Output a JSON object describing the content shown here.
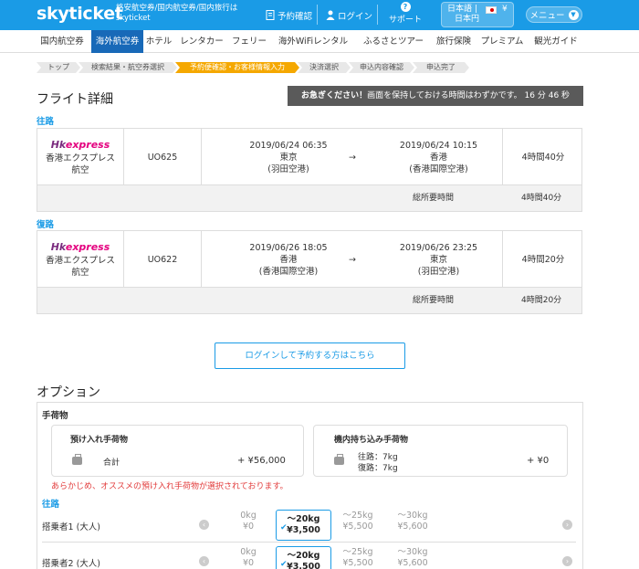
{
  "header": {
    "logo": "skyticket",
    "tagline": "格安航空券/国内航空券/国内旅行は skyticket",
    "booking_check": "予約確認",
    "login": "ログイン",
    "support": "サポート",
    "lang_line1": "日本語 |",
    "lang_line2": "日本円",
    "currency": "¥",
    "menu": "メニュー"
  },
  "nav": [
    "国内航空券",
    "海外航空券",
    "ホテル",
    "レンタカー",
    "フェリー",
    "海外WiFiレンタル",
    "ふるさとツアー",
    "旅行保険",
    "プレミアム",
    "観光ガイド"
  ],
  "breadcrumb": [
    "トップ",
    "検索結果・航空券選択",
    "予約便確認・お客様情報入力",
    "決済選択",
    "申込内容確認",
    "申込完了"
  ],
  "flight_detail": {
    "title": "フライト詳細",
    "timer_bold": "お急ぎください！",
    "timer_text": "画面を保持しておける時間はわずかです。 16 分 46 秒",
    "total_label": "総所要時間",
    "arrow": "→"
  },
  "outbound": {
    "label": "往路",
    "logo_hk": "Hk",
    "logo_express": "express",
    "airline": "香港エクスプレス航空",
    "flight_no": "UO625",
    "dep_time": "2019/06/24 06:35",
    "dep_city": "東京",
    "dep_airport": "(羽田空港)",
    "arr_time": "2019/06/24 10:15",
    "arr_city": "香港",
    "arr_airport": "(香港国際空港)",
    "duration": "4時間40分",
    "total": "4時間40分"
  },
  "return": {
    "label": "復路",
    "logo_hk": "Hk",
    "logo_express": "express",
    "airline": "香港エクスプレス航空",
    "flight_no": "UO622",
    "dep_time": "2019/06/26 18:05",
    "dep_city": "香港",
    "dep_airport": "(香港国際空港)",
    "arr_time": "2019/06/26 23:25",
    "arr_city": "東京",
    "arr_airport": "(羽田空港)",
    "duration": "4時間20分",
    "total": "4時間20分"
  },
  "login_button": "ログインして予約する方はこちら",
  "options": {
    "title": "オプション",
    "baggage_label": "手荷物",
    "checked": {
      "title": "預け入れ手荷物",
      "total_label": "合計",
      "total": "+ ¥56,000"
    },
    "carry_on": {
      "title": "機内持ち込み手荷物",
      "outbound": "往路：7kg",
      "return": "復路：7kg",
      "price": "+ ¥0"
    },
    "note": "あらかじめ、オススメの預け入れ手荷物が選択されております。",
    "direction": "往路",
    "passengers": [
      {
        "name": "搭乗者1 (大人)",
        "weights": [
          {
            "w": "0kg",
            "p": "¥0"
          },
          {
            "w": "〜20kg",
            "p": "¥3,500"
          },
          {
            "w": "〜25kg",
            "p": "¥5,500"
          },
          {
            "w": "〜30kg",
            "p": "¥5,600"
          }
        ]
      },
      {
        "name": "搭乗者2 (大人)",
        "weights": [
          {
            "w": "0kg",
            "p": "¥0"
          },
          {
            "w": "〜20kg",
            "p": "¥3,500"
          },
          {
            "w": "〜25kg",
            "p": "¥5,500"
          },
          {
            "w": "〜30kg",
            "p": "¥5,600"
          }
        ]
      }
    ]
  },
  "colors": {
    "brand": "#1a9be6",
    "nav_active": "#1869b8",
    "crumb_current": "#f5a800",
    "warning": "#e23c3c"
  }
}
